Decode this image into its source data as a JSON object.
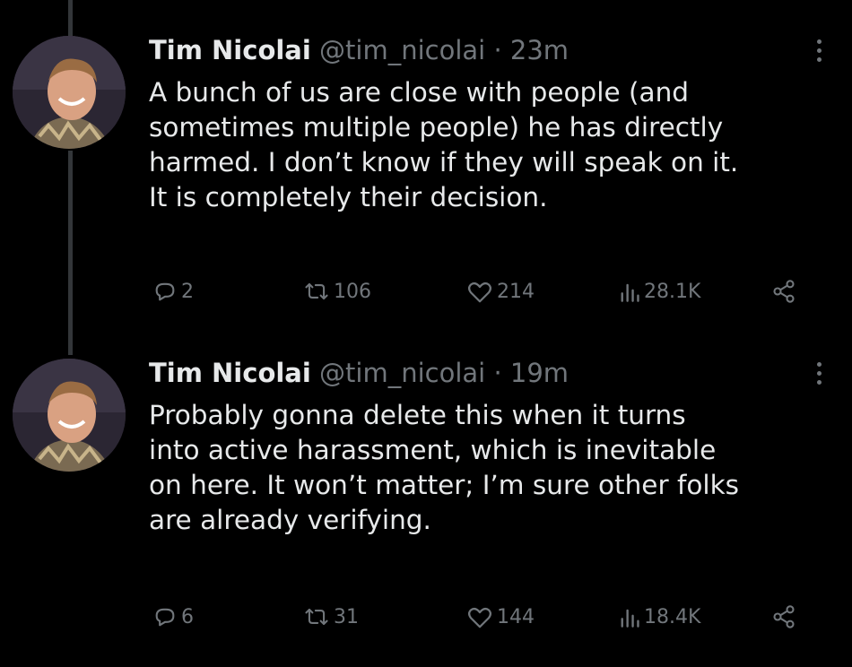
{
  "tweets": [
    {
      "display_name": "Tim Nicolai",
      "handle": "@tim_nicolai",
      "separator": "·",
      "time": "23m",
      "text_lines": [
        "A bunch of us are close with people (and",
        "sometimes multiple people) he has directly",
        "harmed. I don’t know if they will speak on it.",
        "It is completely their decision."
      ],
      "stats": {
        "replies": "2",
        "retweets": "106",
        "likes": "214",
        "views": "28.1K"
      }
    },
    {
      "display_name": "Tim Nicolai",
      "handle": "@tim_nicolai",
      "separator": "·",
      "time": "19m",
      "text_lines": [
        "Probably gonna delete this when it turns",
        "into active harassment, which is inevitable",
        "on here. It won’t matter; I’m sure other folks",
        "are already verifying."
      ],
      "stats": {
        "replies": "6",
        "retweets": "31",
        "likes": "144",
        "views": "18.4K"
      }
    }
  ],
  "icons": {
    "reply": "reply-icon",
    "retweet": "retweet-icon",
    "like": "heart-icon",
    "views": "views-chart-icon",
    "share": "share-icon",
    "more": "more-vertical-icon"
  },
  "colors": {
    "background": "#000000",
    "primary_text": "#e7e9ea",
    "secondary_text": "#71767b",
    "thread_line": "#333639"
  }
}
